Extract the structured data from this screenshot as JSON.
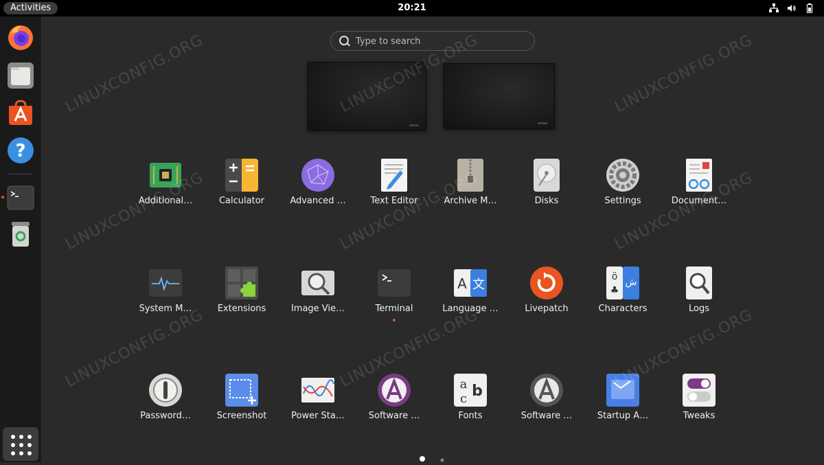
{
  "topbar": {
    "activities_label": "Activities",
    "clock": "20:21",
    "tray_icons": [
      "network-icon",
      "volume-icon",
      "battery-icon"
    ]
  },
  "dock": {
    "items": [
      {
        "name": "firefox",
        "icon": "firefox-icon"
      },
      {
        "name": "files",
        "icon": "files-icon"
      },
      {
        "name": "software",
        "icon": "app-center-icon"
      },
      {
        "name": "help",
        "icon": "help-icon"
      },
      {
        "name": "terminal",
        "icon": "terminal-icon",
        "running": true
      },
      {
        "name": "trash",
        "icon": "trash-icon"
      }
    ],
    "show_apps_icon": "app-grid-icon"
  },
  "search": {
    "placeholder": "Type to search"
  },
  "workspaces": [
    {
      "active": true
    },
    {
      "active": false
    }
  ],
  "apps": [
    {
      "label": "Additional…",
      "icon": "chip-icon"
    },
    {
      "label": "Calculator",
      "icon": "calculator-icon"
    },
    {
      "label": "Advanced …",
      "icon": "advanced-network-icon"
    },
    {
      "label": "Text Editor",
      "icon": "text-editor-icon"
    },
    {
      "label": "Archive M…",
      "icon": "archive-icon"
    },
    {
      "label": "Disks",
      "icon": "disks-icon"
    },
    {
      "label": "Settings",
      "icon": "settings-icon"
    },
    {
      "label": "Document…",
      "icon": "document-viewer-icon"
    },
    {
      "label": "System M…",
      "icon": "system-monitor-icon"
    },
    {
      "label": "Extensions",
      "icon": "extensions-icon"
    },
    {
      "label": "Image Vie…",
      "icon": "image-viewer-icon"
    },
    {
      "label": "Terminal",
      "icon": "terminal-icon",
      "running": true
    },
    {
      "label": "Language …",
      "icon": "language-icon"
    },
    {
      "label": "Livepatch",
      "icon": "livepatch-icon"
    },
    {
      "label": "Characters",
      "icon": "characters-icon"
    },
    {
      "label": "Logs",
      "icon": "logs-icon"
    },
    {
      "label": "Password…",
      "icon": "password-icon"
    },
    {
      "label": "Screenshot",
      "icon": "screenshot-icon"
    },
    {
      "label": "Power Sta…",
      "icon": "power-statistics-icon"
    },
    {
      "label": "Software …",
      "icon": "software-properties-icon"
    },
    {
      "label": "Fonts",
      "icon": "fonts-icon"
    },
    {
      "label": "Software …",
      "icon": "software-updater-icon"
    },
    {
      "label": "Startup A…",
      "icon": "startup-apps-icon"
    },
    {
      "label": "Tweaks",
      "icon": "tweaks-icon"
    }
  ],
  "pager": {
    "pages": 2,
    "current": 1
  },
  "watermark": {
    "text": "LINUXCONFIG.ORG"
  },
  "colors": {
    "accent": "#e95420",
    "background": "#2a2a2a",
    "topbar": "#000000",
    "dock": "#1a1a1a"
  }
}
